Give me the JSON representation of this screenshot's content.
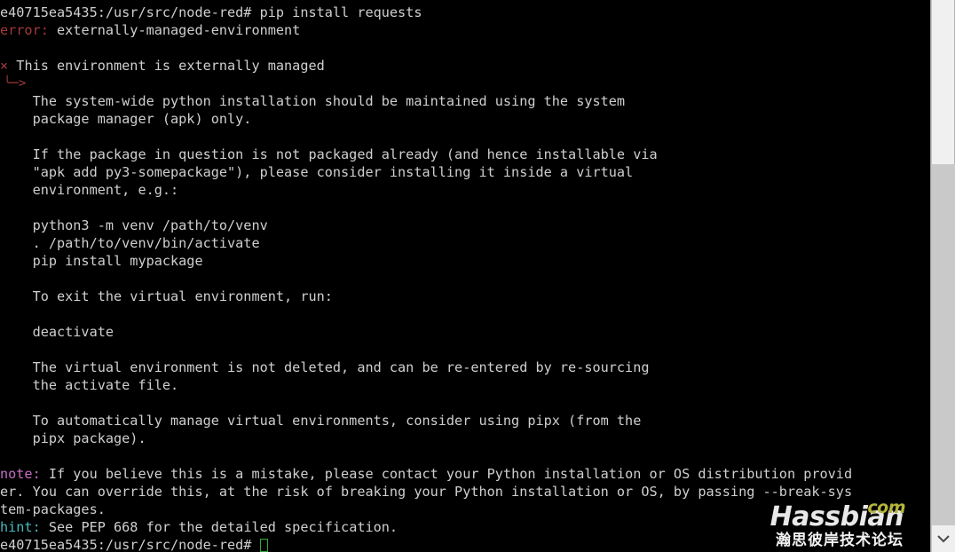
{
  "window": {
    "background_color": "#000000",
    "foreground_color": "#cfcfcf"
  },
  "colors": {
    "error": "#a33a3a",
    "note": "#c66fc6",
    "hint": "#47b9bd",
    "cursor": "#2faa3a",
    "watermark_com": "#b5b53a"
  },
  "terminal": {
    "prompt": "e40715ea5435:/usr/src/node-red#",
    "command": "pip install requests",
    "lines": [
      {
        "id": "prompt-command",
        "text": "e40715ea5435:/usr/src/node-red# pip install requests"
      },
      {
        "id": "error-headline",
        "text": "error: externally-managed-environment"
      },
      {
        "id": "blank-1",
        "text": ""
      },
      {
        "id": "bullet-headline",
        "text": "× This environment is externally managed"
      },
      {
        "id": "arrow-marker",
        "text": "╰─>"
      },
      {
        "id": "body-1",
        "text": "    The system-wide python installation should be maintained using the system"
      },
      {
        "id": "body-2",
        "text": "    package manager (apk) only."
      },
      {
        "id": "blank-2",
        "text": ""
      },
      {
        "id": "body-3",
        "text": "    If the package in question is not packaged already (and hence installable via"
      },
      {
        "id": "body-4",
        "text": "    \"apk add py3-somepackage\"), please consider installing it inside a virtual"
      },
      {
        "id": "body-5",
        "text": "    environment, e.g.:"
      },
      {
        "id": "blank-3",
        "text": ""
      },
      {
        "id": "cmd-1",
        "text": "    python3 -m venv /path/to/venv"
      },
      {
        "id": "cmd-2",
        "text": "    . /path/to/venv/bin/activate"
      },
      {
        "id": "cmd-3",
        "text": "    pip install mypackage"
      },
      {
        "id": "blank-4",
        "text": ""
      },
      {
        "id": "body-6",
        "text": "    To exit the virtual environment, run:"
      },
      {
        "id": "blank-5",
        "text": ""
      },
      {
        "id": "cmd-4",
        "text": "    deactivate"
      },
      {
        "id": "blank-6",
        "text": ""
      },
      {
        "id": "body-7",
        "text": "    The virtual environment is not deleted, and can be re-entered by re-sourcing"
      },
      {
        "id": "body-8",
        "text": "    the activate file."
      },
      {
        "id": "blank-7",
        "text": ""
      },
      {
        "id": "body-9",
        "text": "    To automatically manage virtual environments, consider using pipx (from the"
      },
      {
        "id": "body-10",
        "text": "    pipx package)."
      },
      {
        "id": "blank-8",
        "text": ""
      },
      {
        "id": "note-1",
        "text": "If you believe this is a mistake, please contact your Python installation or OS distribution provid"
      },
      {
        "id": "note-2",
        "text": "er. You can override this, at the risk of breaking your Python installation or OS, by passing --break-sys"
      },
      {
        "id": "note-3",
        "text": "tem-packages."
      },
      {
        "id": "hint-1",
        "text": "See PEP 668 for the detailed specification."
      },
      {
        "id": "final-prompt",
        "text": "e40715ea5435:/usr/src/node-red#"
      }
    ],
    "label_error": "error:",
    "label_note": "note:",
    "label_hint": "hint:",
    "bullet_mark": "×",
    "arrow_mark": "╰─>"
  },
  "watermark": {
    "suffix": "com",
    "brand": "Hassbian",
    "subtitle": "瀚思彼岸技术论坛"
  },
  "scrollbar": {
    "name": "vertical-scrollbar",
    "down_arrow_icon": "chevron-down-icon"
  }
}
